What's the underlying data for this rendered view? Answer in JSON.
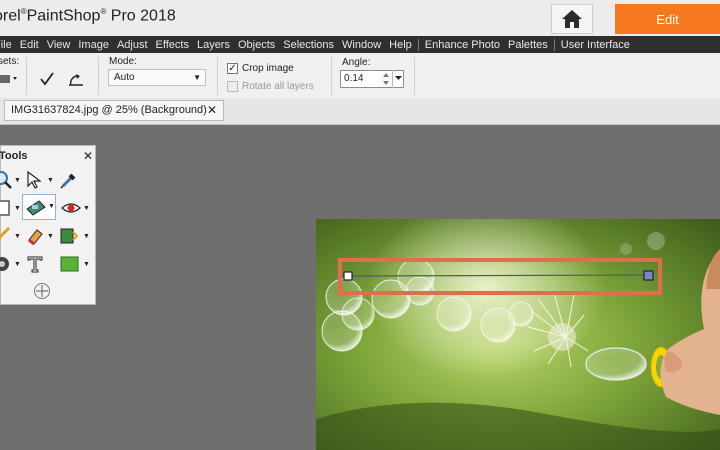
{
  "app": {
    "title_prefix": "orel",
    "title_name": "PaintShop",
    "title_suffix": "Pro 2018",
    "registered_mark": "®",
    "edit_label": "Edit",
    "accent_color": "#f6781f"
  },
  "menu": {
    "items": [
      "File",
      "Edit",
      "View",
      "Image",
      "Adjust",
      "Effects",
      "Layers",
      "Objects",
      "Selections",
      "Window",
      "Help",
      "Enhance Photo",
      "Palettes",
      "User Interface"
    ]
  },
  "options": {
    "presets_label": "sets:",
    "mode_label": "Mode:",
    "mode_value": "Auto",
    "crop_image_label": "Crop image",
    "crop_image_checked": true,
    "rotate_layers_label": "Rotate all layers",
    "rotate_layers_checked": false,
    "angle_label": "Angle:",
    "angle_value": "0.14"
  },
  "document": {
    "tab_title": "IMG31637824.jpg @  25% (Background)",
    "close_symbol": "✕"
  },
  "tools_palette": {
    "title": "Tools",
    "close_symbol": "✕"
  },
  "icons": [
    "home-icon",
    "checkmark-icon",
    "crop-tool-icon",
    "zoom-icon",
    "pick-arrow-icon",
    "dropper-icon",
    "selection-icon",
    "straighten-icon",
    "redeye-icon",
    "paintbrush-icon",
    "eraser-icon",
    "flood-fill-icon",
    "clone-icon",
    "text-icon",
    "shape-icon",
    "move-icon",
    "close-icon"
  ],
  "colors": {
    "crop_frame": "#e36c4c",
    "menu_bg": "#2f2f2f",
    "shape_fill": "#5ab13a"
  }
}
